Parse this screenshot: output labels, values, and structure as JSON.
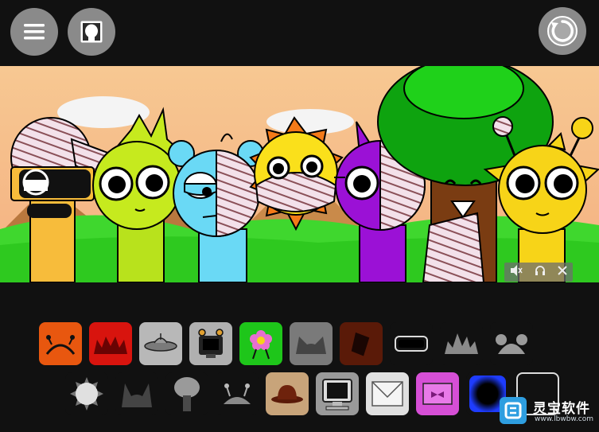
{
  "toolbar": {
    "menu_icon": "hamburger-menu-icon",
    "portrait_icon": "character-portrait-icon",
    "reset_icon": "circular-reset-icon"
  },
  "stage": {
    "characters": [
      "orange-bandaged-character",
      "lime-spiky-character",
      "blue-bear-character",
      "yellow-sun-character",
      "purple-horn-character",
      "brown-tree-character",
      "yellow-antenna-character"
    ]
  },
  "media_controls": {
    "mute_icon": "mute-icon",
    "headphones_icon": "headphones-icon",
    "close_icon": "close-icon"
  },
  "palette": {
    "row1": [
      {
        "name": "orange-antenna-sound",
        "color": "#e8570f"
      },
      {
        "name": "red-spike-sound",
        "color": "#d8140e"
      },
      {
        "name": "gray-ufo-sound",
        "color": "#b8b8b8"
      },
      {
        "name": "gray-robot-sound",
        "color": "#b0b0b0"
      },
      {
        "name": "green-flower-sound",
        "color": "#1ec61a"
      },
      {
        "name": "gray-cat-ears-sound",
        "color": "#7a7a7a"
      },
      {
        "name": "brown-bucket-sound",
        "color": "#5a1a08"
      },
      {
        "name": "black-visor-sound",
        "color": "#111111"
      },
      {
        "name": "gray-crown-sound",
        "color": "#111111"
      },
      {
        "name": "gray-bear-ears-sound",
        "color": "#111111"
      }
    ],
    "row2": [
      {
        "name": "white-sun-sound",
        "color": "#111111"
      },
      {
        "name": "dark-horns-sound",
        "color": "#111111"
      },
      {
        "name": "gray-tree-sound",
        "color": "#111111"
      },
      {
        "name": "gray-antenna-sound",
        "color": "#111111"
      },
      {
        "name": "tan-hat-sound",
        "color": "#c8a47a"
      },
      {
        "name": "gray-monitor-sound",
        "color": "#9a9a9a"
      },
      {
        "name": "white-envelope-sound",
        "color": "#e0e0e0"
      },
      {
        "name": "pink-bow-sound",
        "color": "#d64fd6"
      },
      {
        "name": "blue-glow-sound",
        "color": "#111111"
      },
      {
        "name": "black-empty-sound",
        "color": "#111111"
      }
    ]
  },
  "watermark": {
    "name": "灵宝软件",
    "url": "www.lbwbw.com"
  }
}
